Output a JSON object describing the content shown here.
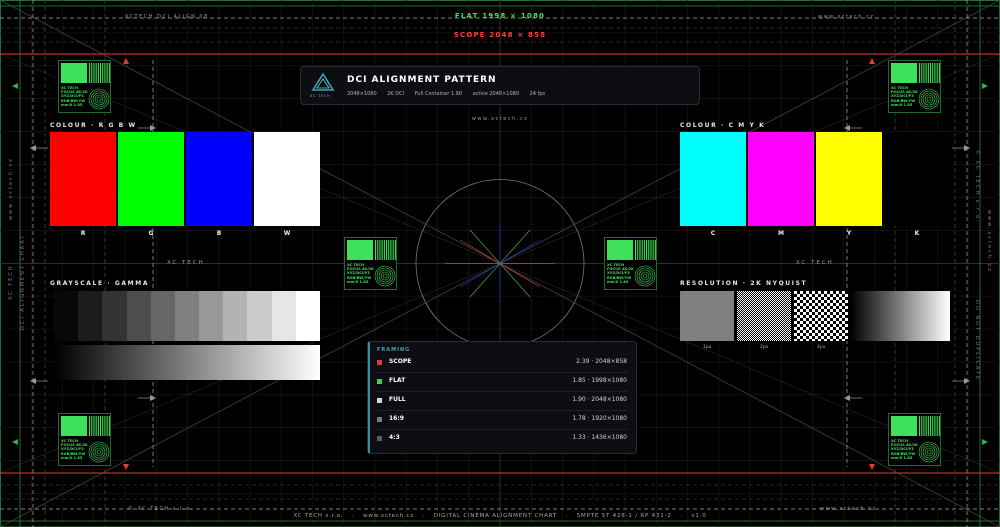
{
  "top": {
    "flat_label": "FLAT  1998 × 1080",
    "scope_label": "SCOPE  2048 × 858",
    "top_left_small": "XCTECH DCI ALIGN 08",
    "top_right_small": "www.xctech.cz",
    "bottom_left_small": "© XC TECH s.r.o.",
    "bottom_right_small": "www.xctech.cz"
  },
  "header": {
    "logo_text": "XC TECH",
    "title": "DCI ALIGNMENT PATTERN",
    "sub": [
      "2048×1080",
      "2K DCI",
      "Full Container 1.90",
      "active 2048×1080",
      "24 fps"
    ],
    "url": "www.xctech.cz"
  },
  "rgbw": {
    "title": "COLOUR · R G B W",
    "labels": [
      "R",
      "G",
      "B",
      "W"
    ],
    "colors": [
      "#ff0000",
      "#00ff00",
      "#0000ff",
      "#ffffff"
    ]
  },
  "cmyk": {
    "title": "COLOUR · C M Y K",
    "labels": [
      "C",
      "M",
      "Y",
      "K"
    ],
    "colors": [
      "#00ffff",
      "#ff00ff",
      "#ffff00",
      "#000000"
    ]
  },
  "grayscale": {
    "title": "GRAYSCALE · GAMMA",
    "steps": [
      "#080808",
      "#1c1c1c",
      "#333333",
      "#4d4d4d",
      "#666666",
      "#808080",
      "#999999",
      "#b3b3b3",
      "#cccccc",
      "#e6e6e6",
      "#ffffff"
    ]
  },
  "resolution": {
    "title": "RESOLUTION · 2K NYQUIST",
    "labels": [
      "1px",
      "2px",
      "4px"
    ]
  },
  "center": {
    "left_label": "XC TECH",
    "right_label": "XC TECH"
  },
  "framing": {
    "title": "FRAMING",
    "rows": [
      {
        "name": "SCOPE",
        "value": "2.39 · 2048×858",
        "color": "#e03a3a"
      },
      {
        "name": "FLAT",
        "value": "1.85 · 1998×1080",
        "color": "#3ccf55"
      },
      {
        "name": "FULL",
        "value": "1.90 · 2048×1080",
        "color": "#d8d8d8"
      },
      {
        "name": "16:9",
        "value": "1.78 · 1920×1080",
        "color": "#6f7f88"
      },
      {
        "name": "4:3",
        "value": "1.33 · 1436×1080",
        "color": "#5b5f63"
      }
    ]
  },
  "lock_box": {
    "text": "XC TECH\nFOCUS 4K/2K\nXYZ/DCI/P3\nRGB/BW/YW\nmm/0 1.85"
  },
  "side": {
    "left_outer": "XC TECH",
    "left_inner": "DCI ALIGNMENT CHART",
    "left_url": "www.xctech.cz",
    "right_outer": "© XC TECH s.r.o.",
    "right_inner": "DO NOT DUPLICATE",
    "right_url": "www.xctech.cz"
  },
  "footer": {
    "items": [
      "XC TECH s.r.o.",
      "·",
      "www.xctech.cz",
      "·",
      "DIGITAL CINEMA ALIGNMENT CHART",
      "·",
      "SMPTE ST 428-1 / RP 431-2",
      "·",
      "v1.0"
    ]
  }
}
